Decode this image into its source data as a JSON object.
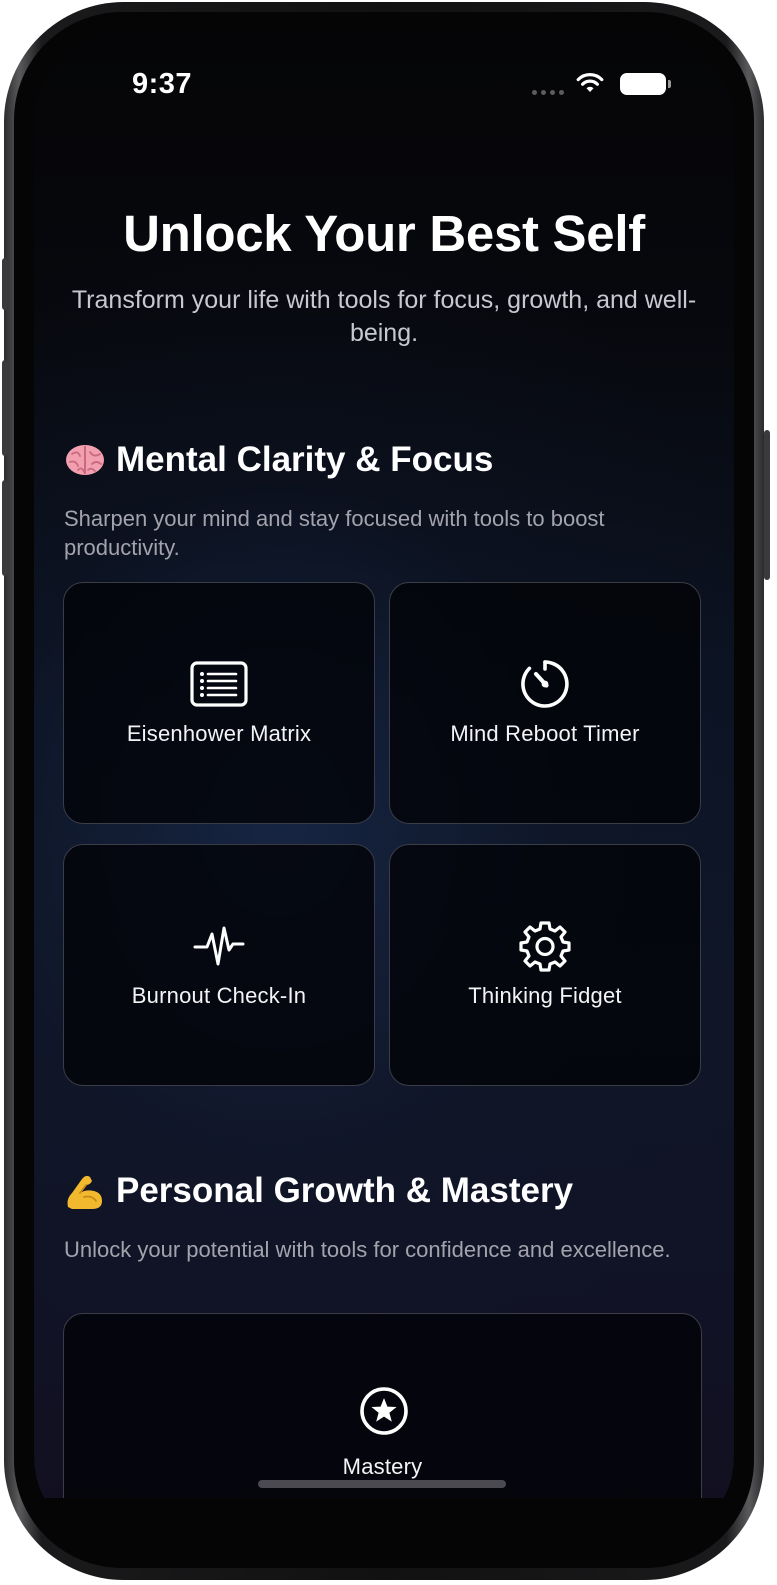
{
  "status_bar": {
    "time": "9:37"
  },
  "header": {
    "title": "Unlock Your Best Self",
    "subtitle": "Transform your life with tools for focus, growth, and well-being."
  },
  "sections": [
    {
      "emoji_name": "brain-emoji",
      "title": "Mental Clarity & Focus",
      "description": "Sharpen your mind and stay focused with tools to boost productivity.",
      "tools": [
        {
          "label": "Eisenhower Matrix",
          "icon": "list-icon"
        },
        {
          "label": "Mind Reboot Timer",
          "icon": "timer-icon"
        },
        {
          "label": "Burnout Check-In",
          "icon": "pulse-icon"
        },
        {
          "label": "Thinking Fidget",
          "icon": "gear-icon"
        }
      ]
    },
    {
      "emoji_name": "flexed-biceps-emoji",
      "title": "Personal Growth & Mastery",
      "description": "Unlock your potential with tools for confidence and excellence.",
      "tools": [
        {
          "label": "Mastery",
          "icon": "star-circle-icon"
        }
      ]
    }
  ],
  "colors": {
    "background_top": "#050507",
    "background_mid": "#0c1424",
    "tile_border": "#3a3d46",
    "secondary_text": "#a3a3ad"
  }
}
